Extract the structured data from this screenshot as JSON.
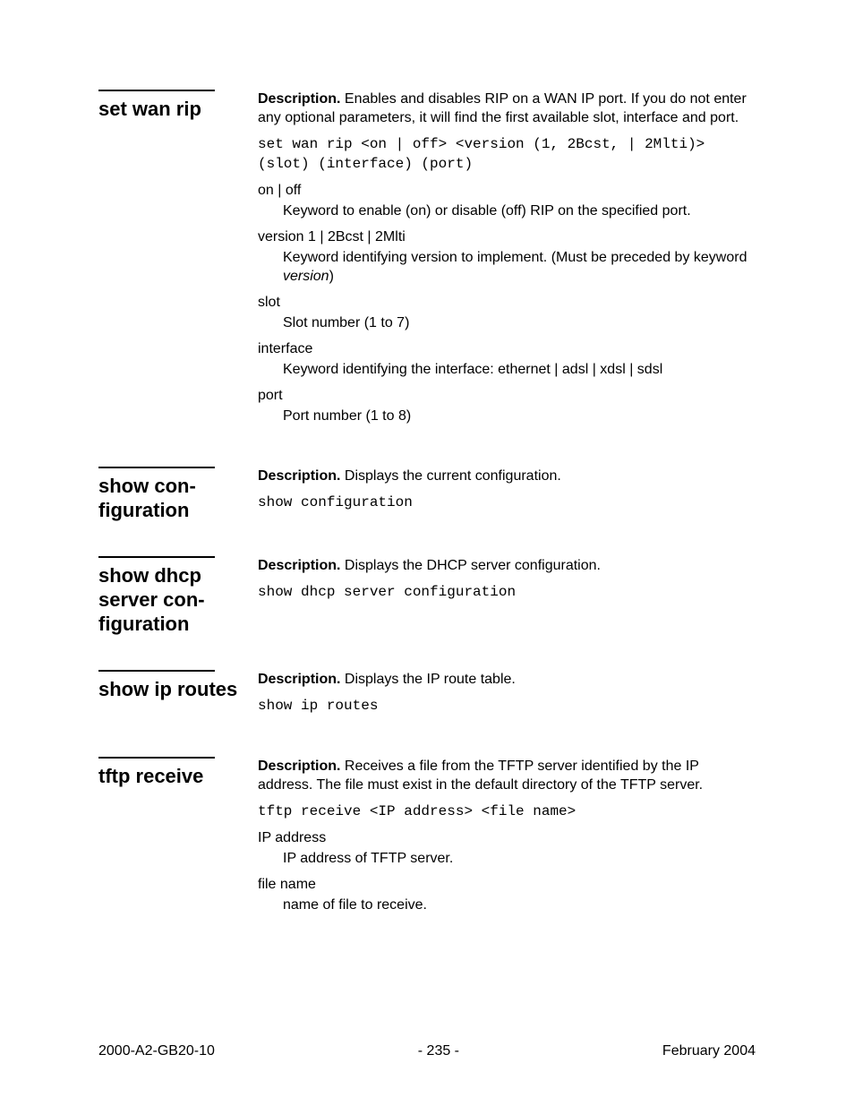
{
  "entries": [
    {
      "name": "set wan rip",
      "description": "Enables and disables RIP on a WAN IP port. If you do not enter any optional parameters, it will find the first available slot, interface and port.",
      "syntax": "set wan rip <on | off> <version (1, 2Bcst, | 2Mlti)> (slot) (interface) (port)",
      "params": [
        {
          "term": "on | off",
          "def": "Keyword to enable (on) or disable (off) RIP on the specified port."
        },
        {
          "term": "version 1 | 2Bcst | 2Mlti",
          "def_prefix": "Keyword identifying version to implement. (Must be preceded by keyword ",
          "def_italic": "version",
          "def_suffix": ")"
        },
        {
          "term": "slot",
          "def": "Slot number (1 to 7)"
        },
        {
          "term": "interface",
          "def": "Keyword identifying the interface: ethernet | adsl | xdsl | sdsl"
        },
        {
          "term": "port",
          "def": "Port number (1 to 8)"
        }
      ]
    },
    {
      "name": "show con-figuration",
      "description": "Displays the current configuration.",
      "syntax": "show configuration"
    },
    {
      "name": "show dhcp server con-figuration",
      "description": "Displays the DHCP server configuration.",
      "syntax": "show dhcp server configuration"
    },
    {
      "name": "show ip routes",
      "description": "Displays the IP route table.",
      "syntax": "show ip routes"
    },
    {
      "name": "tftp receive",
      "description": "Receives a file from the TFTP server identified by the IP address. The file must exist in the default directory of the TFTP server.",
      "syntax": "tftp receive <IP address> <file name>",
      "params": [
        {
          "term": "IP address",
          "def": "IP address of TFTP server."
        },
        {
          "term": "file name",
          "def": "name of file to receive."
        }
      ]
    }
  ],
  "desc_label": "Description.",
  "footer": {
    "left": "2000-A2-GB20-10",
    "center": "- 235 -",
    "right": "February 2004"
  }
}
